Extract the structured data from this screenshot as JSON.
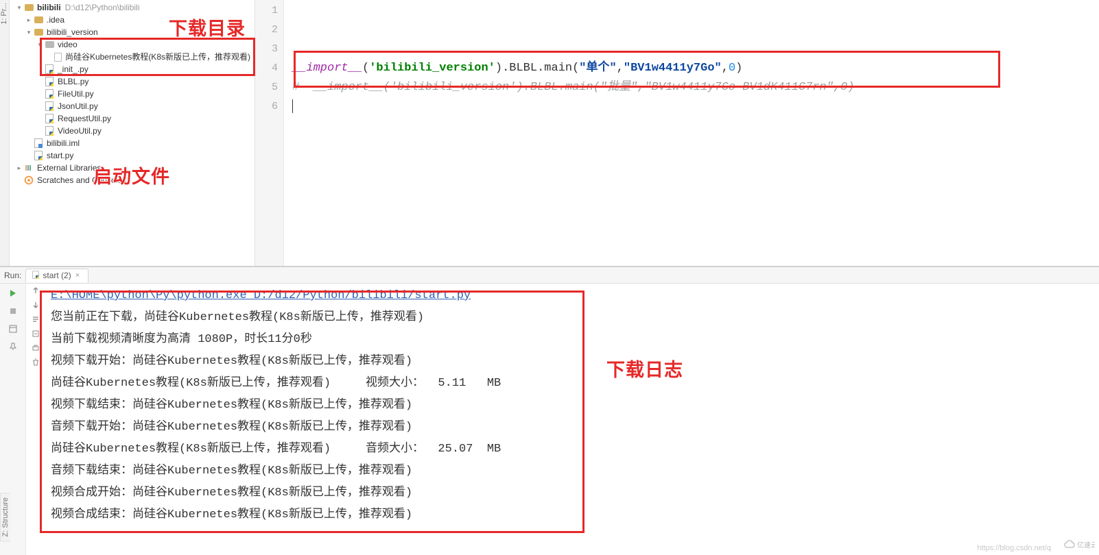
{
  "sidebar": {
    "vertical_tab": "1: Pr...",
    "root": {
      "name": "bilibili",
      "path": "D:\\d12\\Python\\bilibili"
    },
    "idea": ".idea",
    "folder2": "bilibili_version",
    "video": "video",
    "video_item": "尚硅谷Kubernetes教程(K8s新版已上传，推荐观看)",
    "init": "_init_.py",
    "blbl": "BLBL.py",
    "fileutil": "FileUtil.py",
    "jsonutil": "JsonUtil.py",
    "requestutil": "RequestUtil.py",
    "videoutil": "VideoUtil.py",
    "iml": "bilibili.iml",
    "start": "start.py",
    "external": "External Libraries",
    "scratches": "Scratches and Consoles"
  },
  "editor": {
    "lines": [
      "1",
      "2",
      "3",
      "4",
      "5",
      "6"
    ],
    "l4": {
      "pre": "__import__",
      "paren1": "(",
      "s1": "'bilibili_version'",
      "mid1": ").BLBL.main(",
      "d1": "\"单个\"",
      "c1": ",",
      "d2": "\"BV1w4411y7Go\"",
      "c2": ",",
      "num": "0",
      "end": ")"
    },
    "l5": "#  __import__('bilibili_version').BLBL.main(\"批量\",\"BV1w4411y7Go BV1dK411G7rn\",0)"
  },
  "run": {
    "label": "Run:",
    "tab": "start (2)",
    "cmd": "E:\\HOME\\python\\Py\\python.exe D:/d12/Python/bilibili/start.py",
    "lines": [
      "您当前正在下载，尚硅谷Kubernetes教程(K8s新版已上传，推荐观看)",
      "当前下载视频清晰度为高清 1080P，时长11分0秒",
      "视频下载开始：尚硅谷Kubernetes教程(K8s新版已上传，推荐观看)",
      "尚硅谷Kubernetes教程(K8s新版已上传，推荐观看)     视频大小：  5.11   MB",
      "视频下载结束：尚硅谷Kubernetes教程(K8s新版已上传，推荐观看)",
      "音频下载开始：尚硅谷Kubernetes教程(K8s新版已上传，推荐观看)",
      "尚硅谷Kubernetes教程(K8s新版已上传，推荐观看)     音频大小：  25.07  MB",
      "音频下载结束：尚硅谷Kubernetes教程(K8s新版已上传，推荐观看)",
      "视频合成开始：尚硅谷Kubernetes教程(K8s新版已上传，推荐观看)",
      "视频合成结束：尚硅谷Kubernetes教程(K8s新版已上传，推荐观看)"
    ]
  },
  "annotations": {
    "download_dir": "下载目录",
    "start_file": "启动文件",
    "download_log": "下载日志"
  },
  "structure_tab": "Z: Structure",
  "watermark_text": "https://blog.csdn.net/q",
  "watermark_brand": "亿速云"
}
